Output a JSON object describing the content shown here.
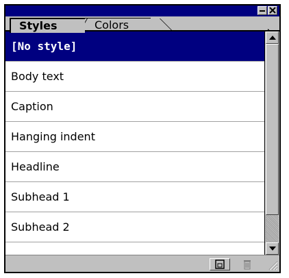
{
  "tabs": [
    {
      "label": "Styles",
      "active": true
    },
    {
      "label": "Colors",
      "active": false
    }
  ],
  "styles_list": [
    "[No style]",
    "Body text",
    "Caption",
    "Hanging indent",
    "Headline",
    "Subhead 1",
    "Subhead 2"
  ],
  "selected_index": 0,
  "colors": {
    "titlebar": "#000080",
    "selection": "#000080",
    "chrome": "#c0c0c0"
  },
  "icons": {
    "minimize": "minimize-icon",
    "close": "close-icon",
    "menu": "palette-menu-arrow-icon",
    "new_style": "new-style-icon",
    "delete": "trash-icon",
    "resize": "resize-grip-icon"
  }
}
